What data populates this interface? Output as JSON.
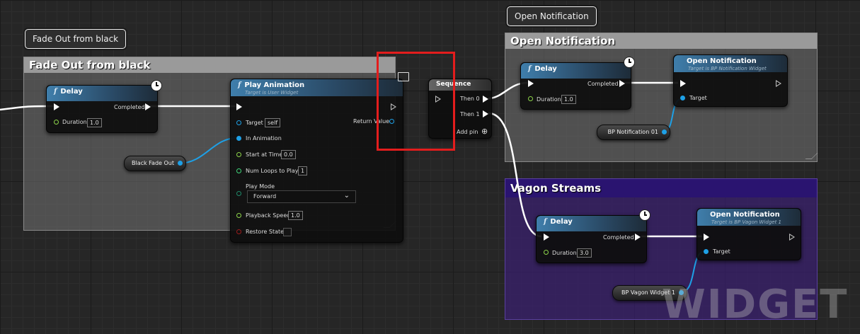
{
  "comments": {
    "fade": {
      "bubble": "Fade Out from black",
      "title": "Fade Out from black",
      "color": "#6b6b6b"
    },
    "open": {
      "bubble": "Open Notification",
      "title": "Open Notification",
      "color": "#6b6b6b"
    },
    "vagon": {
      "title": "Vagon Streams",
      "color": "#2e1a66"
    }
  },
  "nodes": {
    "delay1": {
      "icon": "f",
      "title": "Delay",
      "completed": "Completed",
      "duration_label": "Duration",
      "duration": "1.0"
    },
    "play": {
      "icon": "f",
      "title": "Play Animation",
      "subtitle": "Target is User Widget",
      "target_label": "Target",
      "target_value": "self",
      "in_animation": "In Animation",
      "start_label": "Start at Time",
      "start_value": "0.0",
      "loops_label": "Num Loops to Play",
      "loops_value": "1",
      "mode_label": "Play Mode",
      "mode_value": "Forward",
      "speed_label": "Playback Speed",
      "speed_value": "1.0",
      "restore_label": "Restore State",
      "return_label": "Return Value"
    },
    "black_fade": {
      "label": "Black Fade Out"
    },
    "sequence": {
      "title": "Sequence",
      "then0": "Then 0",
      "then1": "Then 1",
      "add_pin": "Add pin"
    },
    "delay2": {
      "icon": "f",
      "title": "Delay",
      "completed": "Completed",
      "duration_label": "Duration",
      "duration": "1.0"
    },
    "open1": {
      "title": "Open Notification",
      "subtitle": "Target is BP Notification Widget",
      "target_label": "Target"
    },
    "bp_notif": {
      "label": "BP Notification 01"
    },
    "delay3": {
      "icon": "f",
      "title": "Delay",
      "completed": "Completed",
      "duration_label": "Duration",
      "duration": "3.0"
    },
    "open2": {
      "title": "Open Notification",
      "subtitle": "Target is BP Vagon Widget 1",
      "target_label": "Target"
    },
    "bp_vagon": {
      "label": "BP Vagon Widget 1"
    }
  },
  "watermark": "WIDGET BL",
  "icons": {
    "clock": "clock-icon",
    "monitor": "monitor-icon",
    "add": "add-pin-icon",
    "dropdown": "chevron-down-icon"
  },
  "colors": {
    "exec": "#ffffff",
    "object_pin": "#1ea0e6",
    "float_pin": "#8dd44a",
    "int_pin": "#3fd57a",
    "bool_pin": "#9b1c1c",
    "highlight": "#e31d1d",
    "node_header": "#3f7eab"
  }
}
